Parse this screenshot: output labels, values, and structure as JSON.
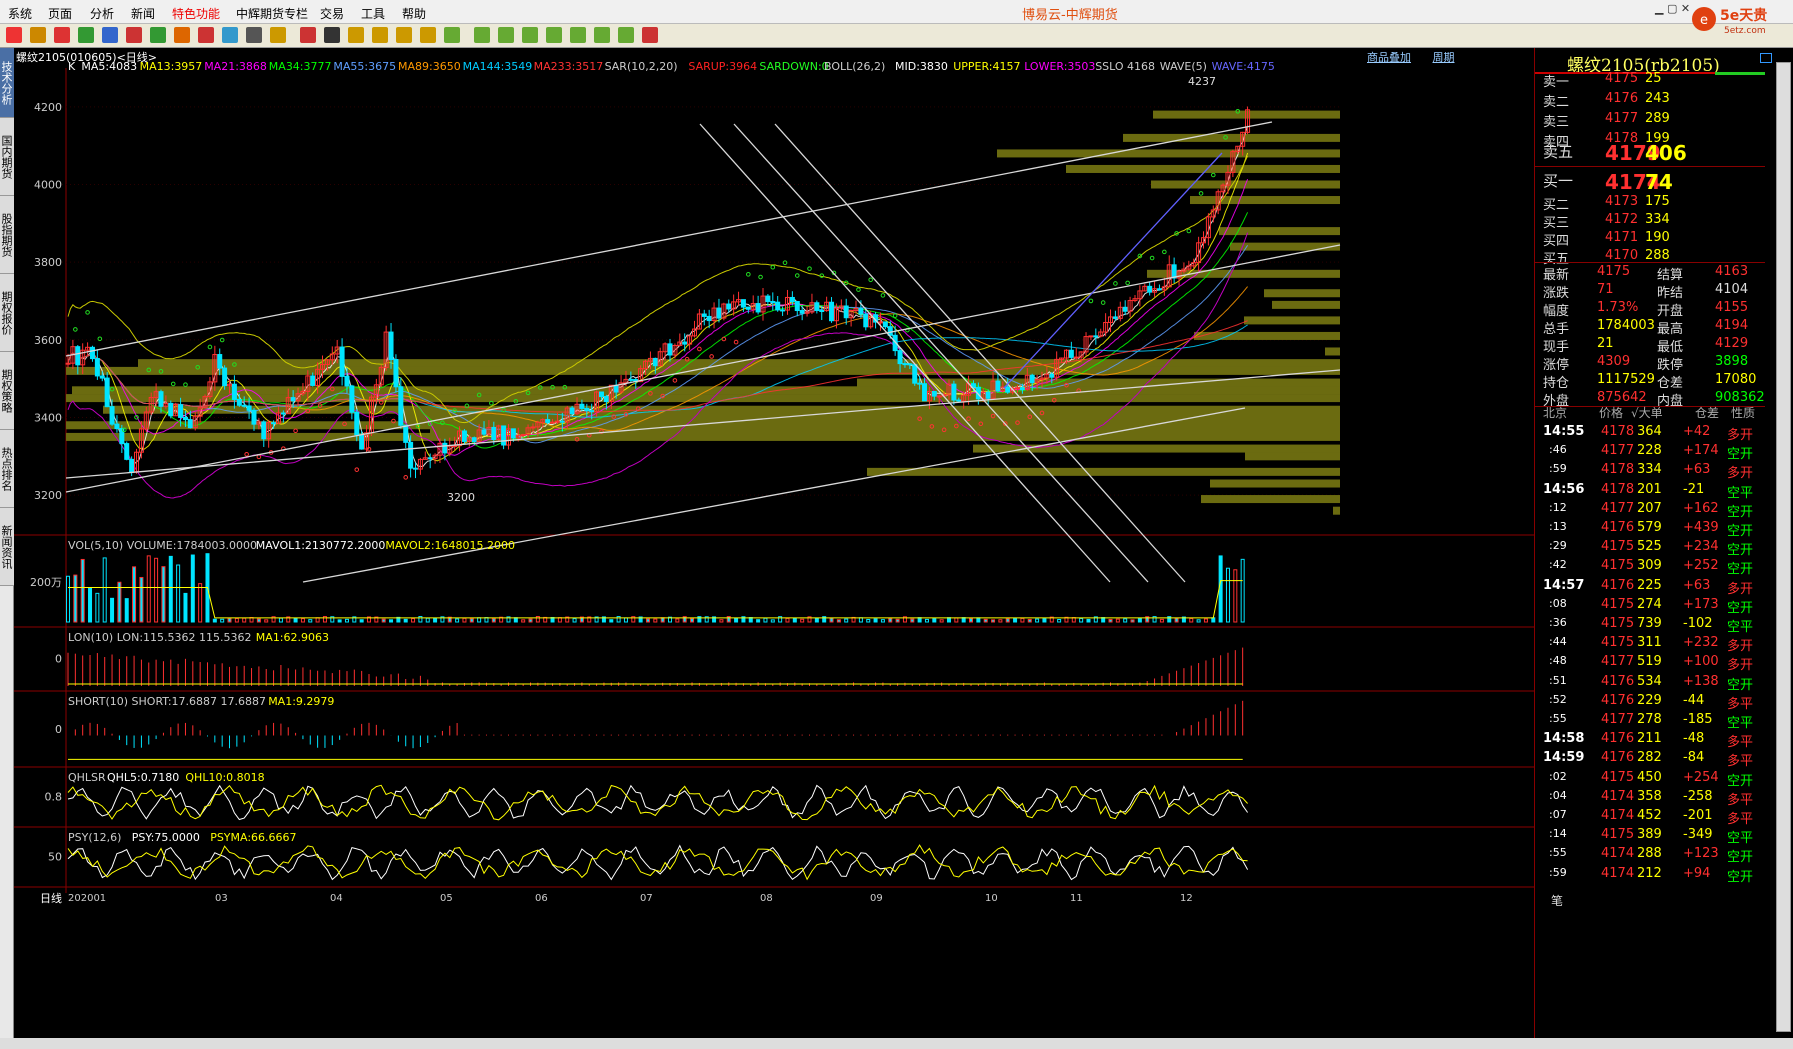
{
  "app": {
    "title": "博易云-中辉期货",
    "menus": [
      "系统",
      "页面",
      "分析",
      "新闻",
      "特色功能",
      "中辉期货专栏",
      "交易",
      "工具",
      "帮助"
    ],
    "logo_text": "5e天贵",
    "logo_sub": "5etz.com"
  },
  "chart_header": {
    "symbol_line": "螺纹2105(010605)<日线>",
    "links": [
      "商品叠加",
      "周期"
    ],
    "period_label": "日线",
    "start_label": "202001"
  },
  "sidebar_tabs": [
    "技术分析",
    "国内期货",
    "股指期货",
    "期权报价",
    "期权策略",
    "热点排名",
    "新闻资讯"
  ],
  "chart_data": [
    {
      "type": "candlestick",
      "panel": "main",
      "ylim": [
        3100,
        4300
      ],
      "yticks": [
        3200,
        3400,
        3600,
        3800,
        4000,
        4200
      ],
      "x_month_labels": [
        "202001",
        "03",
        "04",
        "05",
        "06",
        "07",
        "08",
        "09",
        "10",
        "11",
        "12"
      ],
      "indicators": [
        {
          "label": "K",
          "color": "#ffffff"
        },
        {
          "label": "MA5:4083",
          "color": "#ffffff"
        },
        {
          "label": "MA13:3957",
          "color": "#ffff00"
        },
        {
          "label": "MA21:3868",
          "color": "#ff00ff"
        },
        {
          "label": "MA34:3777",
          "color": "#00ff00"
        },
        {
          "label": "MA55:3675",
          "color": "#5f9fff"
        },
        {
          "label": "MA89:3650",
          "color": "#ff9900"
        },
        {
          "label": "MA144:3549",
          "color": "#00ccff"
        },
        {
          "label": "MA233:3517",
          "color": "#ff3333"
        },
        {
          "label": "SAR(10,2,20)",
          "color": "#cccccc"
        },
        {
          "label": "SARUP:3964",
          "color": "#ff2222"
        },
        {
          "label": "SARDOWN:0",
          "color": "#22ff22"
        },
        {
          "label": "BOLL(26,2)",
          "color": "#cccccc"
        },
        {
          "label": "MID:3830",
          "color": "#ffffff"
        },
        {
          "label": "UPPER:4157",
          "color": "#ffff00"
        },
        {
          "label": "LOWER:3503",
          "color": "#ff00ff"
        },
        {
          "label": "SSLO 4168",
          "color": "#cccccc"
        },
        {
          "label": "WAVE(5)",
          "color": "#cccccc"
        },
        {
          "label": "WAVE:4175",
          "color": "#6666ff"
        }
      ],
      "annotations": [
        "4237",
        "3200"
      ]
    },
    {
      "type": "bar",
      "panel": "volume",
      "title": "VOL(5,10) VOLUME:1784003.0000",
      "series": [
        {
          "name": "MAVOL1:2130772.2000",
          "color": "#ffffff"
        },
        {
          "name": "MAVOL2:1648015.2000",
          "color": "#ffff00"
        }
      ],
      "ytick": "200万"
    },
    {
      "type": "bar",
      "panel": "lon",
      "title": "LON(10) LON:115.5362 115.5362",
      "series": [
        {
          "name": "MA1:62.9063",
          "color": "#ffff00"
        }
      ],
      "ytick": "0"
    },
    {
      "type": "bar",
      "panel": "short",
      "title": "SHORT(10) SHORT:17.6887 17.6887",
      "series": [
        {
          "name": "MA1:9.2979",
          "color": "#ffff00"
        }
      ],
      "ytick": "0"
    },
    {
      "type": "line",
      "panel": "qhlsr",
      "title": "QHLSR",
      "series": [
        {
          "name": "QHL5:0.7180",
          "color": "#ffffff"
        },
        {
          "name": "QHL10:0.8018",
          "color": "#ffff00"
        }
      ],
      "ytick": "0.8"
    },
    {
      "type": "line",
      "panel": "psy",
      "title": "PSY(12,6)",
      "series": [
        {
          "name": "PSY:75.0000",
          "color": "#ffffff"
        },
        {
          "name": "PSYMA:66.6667",
          "color": "#ffff00"
        }
      ],
      "ytick": "50"
    }
  ],
  "quote": {
    "title": "螺纹2105(rb2105)",
    "asks": [
      {
        "label": "卖五",
        "price": "4179",
        "vol": "406"
      },
      {
        "label": "卖四",
        "price": "4178",
        "vol": "199"
      },
      {
        "label": "卖三",
        "price": "4177",
        "vol": "289"
      },
      {
        "label": "卖二",
        "price": "4176",
        "vol": "243"
      },
      {
        "label": "卖一",
        "price": "4175",
        "vol": "25"
      }
    ],
    "bids": [
      {
        "label": "买一",
        "price": "4174",
        "vol": "74"
      },
      {
        "label": "买二",
        "price": "4173",
        "vol": "175"
      },
      {
        "label": "买三",
        "price": "4172",
        "vol": "334"
      },
      {
        "label": "买四",
        "price": "4171",
        "vol": "190"
      },
      {
        "label": "买五",
        "price": "4170",
        "vol": "288"
      }
    ],
    "stats": [
      [
        "最新",
        "4175",
        "结算",
        "4163"
      ],
      [
        "涨跌",
        "71",
        "昨结",
        "4104"
      ],
      [
        "幅度",
        "1.73%",
        "开盘",
        "4155"
      ],
      [
        "总手",
        "1784003",
        "最高",
        "4194"
      ],
      [
        "现手",
        "21",
        "最低",
        "4129"
      ],
      [
        "涨停",
        "4309",
        "跌停",
        "3898"
      ],
      [
        "持仓",
        "1117529",
        "仓差",
        "17080"
      ],
      [
        "外盘",
        "875642",
        "内盘",
        "908362"
      ]
    ],
    "tick_header": [
      "北京",
      "价格",
      "√大单",
      "仓差",
      "性质"
    ],
    "ticks": [
      [
        "14:55",
        "4178",
        "364",
        "+42",
        "多开"
      ],
      [
        ":46",
        "4177",
        "228",
        "+174",
        "空开"
      ],
      [
        ":59",
        "4178",
        "334",
        "+63",
        "多开"
      ],
      [
        "14:56",
        "4178",
        "201",
        "-21",
        "空平"
      ],
      [
        ":12",
        "4177",
        "207",
        "+162",
        "空开"
      ],
      [
        ":13",
        "4176",
        "579",
        "+439",
        "空开"
      ],
      [
        ":29",
        "4175",
        "525",
        "+234",
        "空开"
      ],
      [
        ":42",
        "4175",
        "309",
        "+252",
        "空开"
      ],
      [
        "14:57",
        "4176",
        "225",
        "+63",
        "多开"
      ],
      [
        ":08",
        "4175",
        "274",
        "+173",
        "空开"
      ],
      [
        ":36",
        "4175",
        "739",
        "-102",
        "空平"
      ],
      [
        ":44",
        "4175",
        "311",
        "+232",
        "多开"
      ],
      [
        ":48",
        "4177",
        "519",
        "+100",
        "多开"
      ],
      [
        ":51",
        "4176",
        "534",
        "+138",
        "空开"
      ],
      [
        ":52",
        "4176",
        "229",
        "-44",
        "多平"
      ],
      [
        ":55",
        "4177",
        "278",
        "-185",
        "空平"
      ],
      [
        "14:58",
        "4176",
        "211",
        "-48",
        "多平"
      ],
      [
        "14:59",
        "4176",
        "282",
        "-84",
        "多平"
      ],
      [
        ":02",
        "4175",
        "450",
        "+254",
        "空开"
      ],
      [
        ":04",
        "4174",
        "358",
        "-258",
        "多平"
      ],
      [
        ":07",
        "4174",
        "452",
        "-201",
        "多平"
      ],
      [
        ":14",
        "4175",
        "389",
        "-349",
        "空平"
      ],
      [
        ":55",
        "4174",
        "288",
        "+123",
        "空开"
      ],
      [
        ":59",
        "4174",
        "212",
        "+94",
        "空开"
      ]
    ],
    "bottom_tab": "笔"
  }
}
